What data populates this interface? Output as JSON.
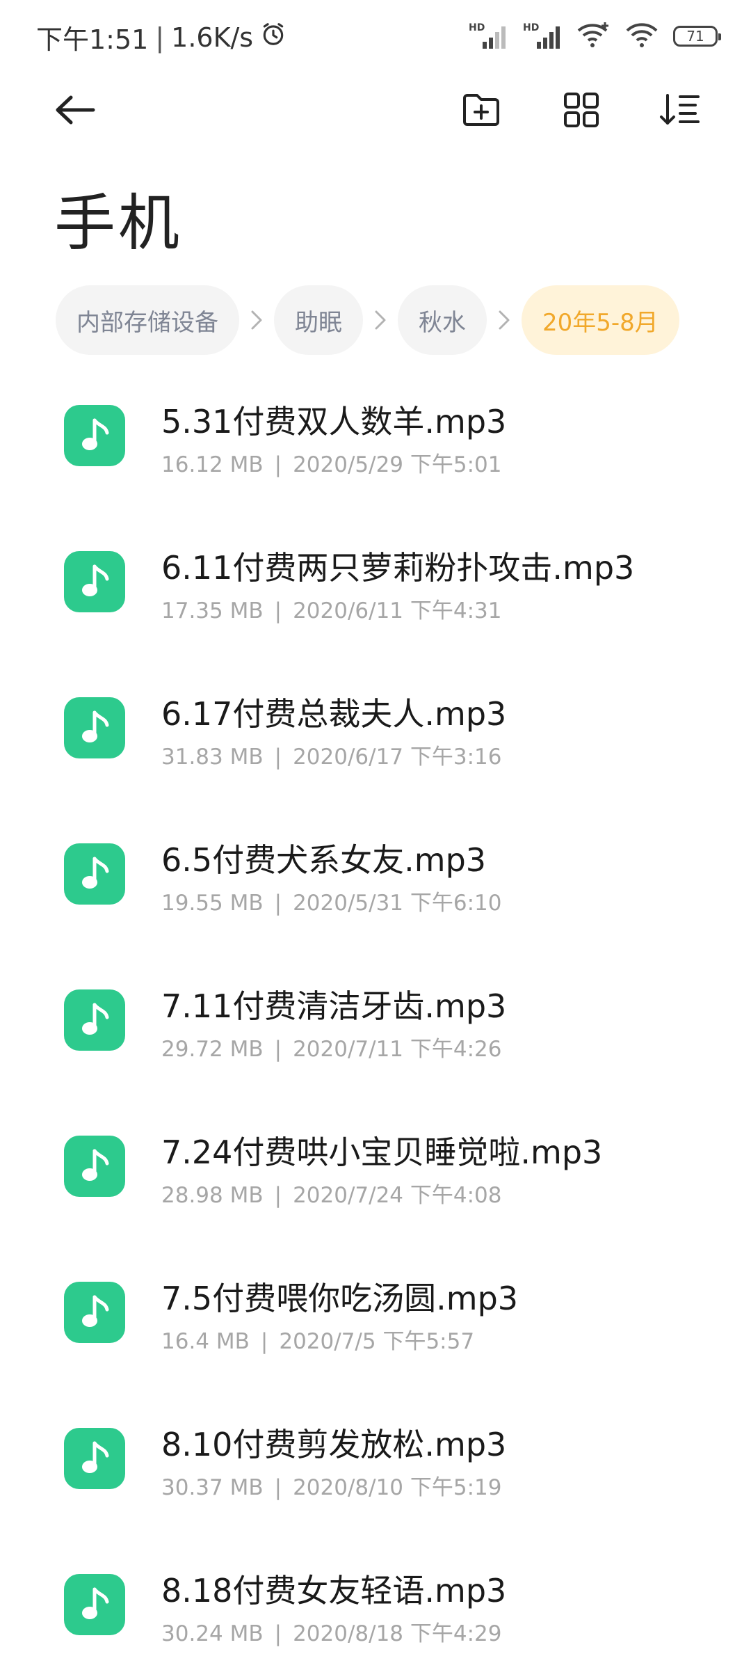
{
  "status_bar": {
    "time": "下午1:51",
    "speed": "1.6K/s",
    "sim1_label": "HD",
    "sim2_label": "HD",
    "battery": "71"
  },
  "toolbar": {
    "back_icon": "arrow-left-icon",
    "new_folder_icon": "folder-plus-icon",
    "grid_icon": "grid-view-icon",
    "sort_icon": "sort-icon"
  },
  "page_title": "手机",
  "breadcrumbs": [
    {
      "label": "内部存储设备",
      "active": false
    },
    {
      "label": "助眠",
      "active": false
    },
    {
      "label": "秋水",
      "active": false
    },
    {
      "label": "20年5-8月",
      "active": true
    }
  ],
  "colors": {
    "accent": "#f1a82b",
    "crumb_active_bg": "#fff3d9",
    "music_icon": "#2dca8d",
    "meta_text": "#a6a6a6"
  },
  "files": [
    {
      "name": "5.31付费双人数羊.mp3",
      "size": "16.12 MB",
      "date": "2020/5/29 下午5:01"
    },
    {
      "name": "6.11付费两只萝莉粉扑攻击.mp3",
      "size": "17.35 MB",
      "date": "2020/6/11 下午4:31"
    },
    {
      "name": "6.17付费总裁夫人.mp3",
      "size": "31.83 MB",
      "date": "2020/6/17 下午3:16"
    },
    {
      "name": "6.5付费犬系女友.mp3",
      "size": "19.55 MB",
      "date": "2020/5/31 下午6:10"
    },
    {
      "name": "7.11付费清洁牙齿.mp3",
      "size": "29.72 MB",
      "date": "2020/7/11 下午4:26"
    },
    {
      "name": "7.24付费哄小宝贝睡觉啦.mp3",
      "size": "28.98 MB",
      "date": "2020/7/24 下午4:08"
    },
    {
      "name": "7.5付费喂你吃汤圆.mp3",
      "size": "16.4 MB",
      "date": "2020/7/5 下午5:57"
    },
    {
      "name": "8.10付费剪发放松.mp3",
      "size": "30.37 MB",
      "date": "2020/8/10 下午5:19"
    },
    {
      "name": "8.18付费女友轻语.mp3",
      "size": "30.24 MB",
      "date": "2020/8/18 下午4:29"
    }
  ],
  "meta_separator": "|"
}
